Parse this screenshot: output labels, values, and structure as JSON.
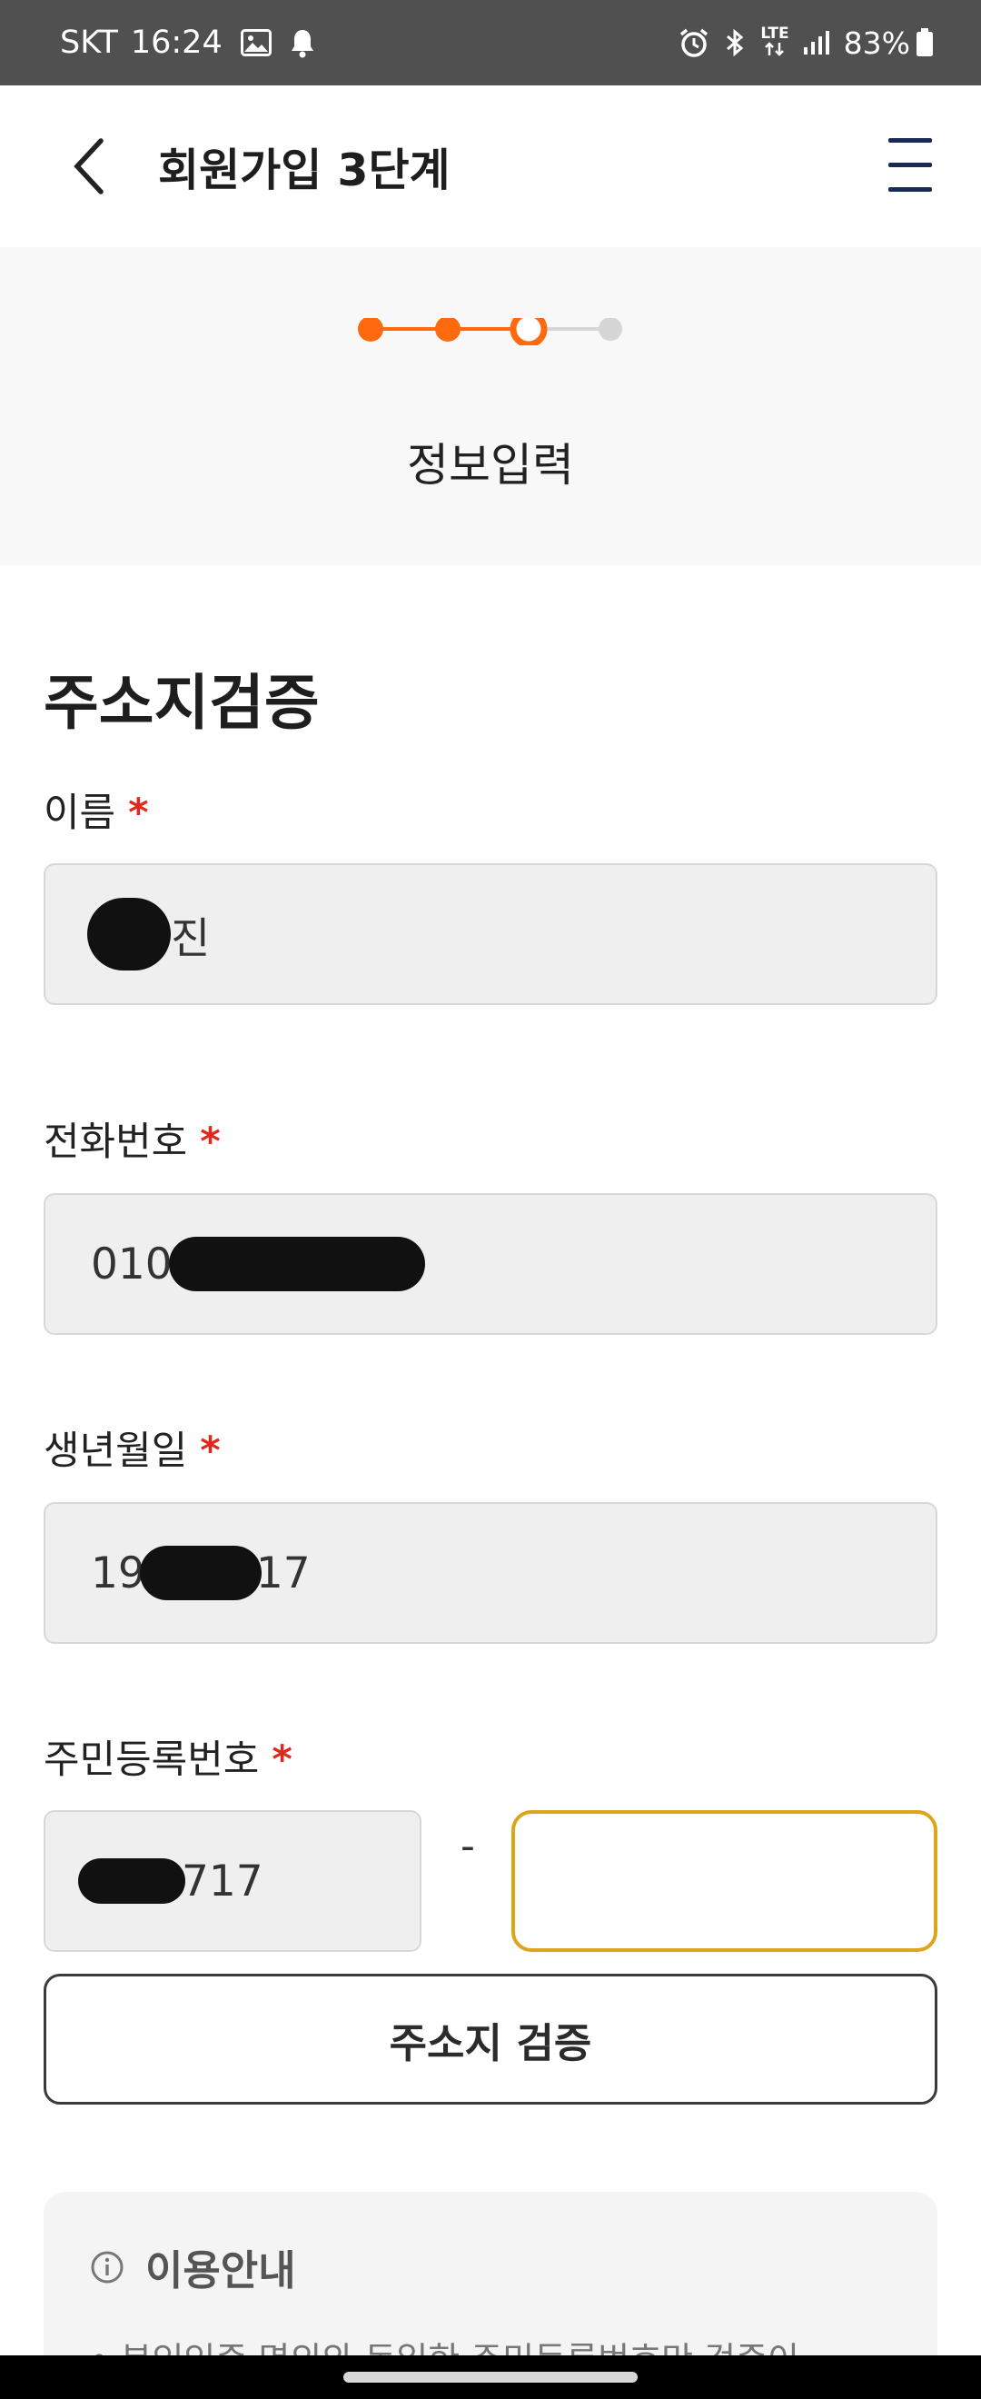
{
  "status_bar": {
    "carrier": "SKT",
    "time": "16:24",
    "lte_label": "LTE",
    "battery": "83%"
  },
  "header": {
    "title": "회원가입 3단계"
  },
  "stepper": {
    "total_steps": 4,
    "current_step": 3,
    "step_title": "정보입력",
    "active_color": "#ff6a0f",
    "inactive_color": "#d6d6d6"
  },
  "form": {
    "section_title": "주소지검증",
    "required_mark": "*",
    "name": {
      "label": "이름",
      "value_visible": "진"
    },
    "phone": {
      "label": "전화번호",
      "value_prefix": "010"
    },
    "birth": {
      "label": "생년월일",
      "value_prefix": "19",
      "value_suffix": "17"
    },
    "rrn": {
      "label": "주민등록번호",
      "front_suffix": "717",
      "separator": "-",
      "back_value": ""
    },
    "verify_button": "주소지 검증"
  },
  "notice": {
    "title": "이용안내",
    "text": "• 본인인증 명의와 동일한 주민등록번호만 검증이"
  },
  "colors": {
    "required": "#e0291e",
    "focus_border": "#dca51b",
    "status_bar_bg": "#505050"
  }
}
